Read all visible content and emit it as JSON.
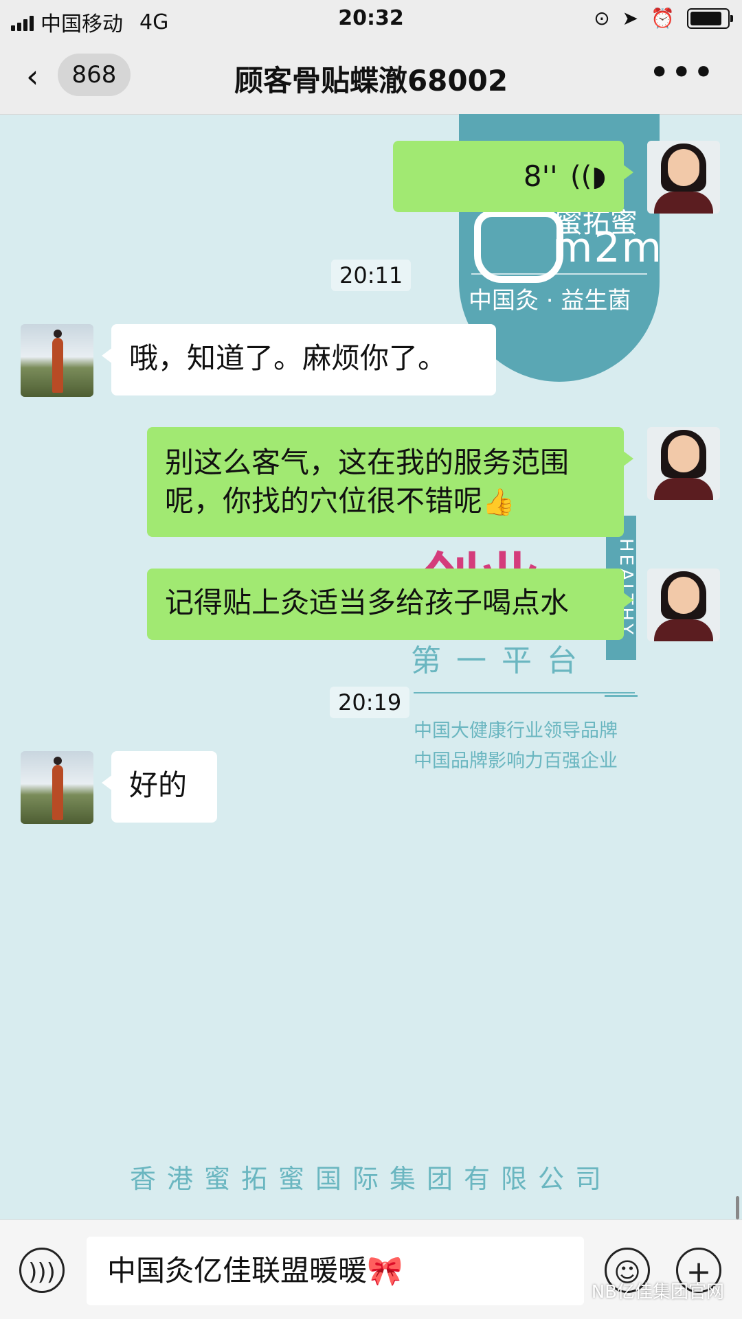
{
  "status_bar": {
    "carrier": "中国移动",
    "network": "4G",
    "time": "20:32",
    "battery_level": 0.9
  },
  "navbar": {
    "unread_badge": "868",
    "title": "顾客骨贴蝶澈68002",
    "more_label": "•••"
  },
  "background_poster": {
    "brand": "蜜拓蜜",
    "brand_latin": "m2m",
    "slogan": "中国灸 · 益生菌",
    "vertical_text": "HEALTHY",
    "platform_text": "第一平台",
    "tagline_1": "中国大健康行业领导品牌",
    "tagline_2": "中国品牌影响力百强企业",
    "company": "香港蜜拓蜜国际集团有限公司"
  },
  "messages": [
    {
      "type": "voice",
      "sender": "me",
      "duration": "8''"
    },
    {
      "type": "timestamp",
      "text": "20:11"
    },
    {
      "type": "text",
      "sender": "them",
      "text": "哦，知道了。麻烦你了。"
    },
    {
      "type": "text",
      "sender": "me",
      "line1": "别这么客气，这在我的服务范围",
      "line2": "呢，你找的穴位很不错呢",
      "emoji": "👍"
    },
    {
      "type": "text",
      "sender": "me",
      "text": "记得贴上灸适当多给孩子喝点水"
    },
    {
      "type": "timestamp",
      "text": "20:19"
    },
    {
      "type": "text",
      "sender": "them",
      "text": "好的"
    }
  ],
  "input_bar": {
    "voice_icon": "voice-icon",
    "draft_text": "中国灸亿佳联盟暖暖",
    "draft_emoji": "🎀",
    "emoji_icon": "smiley-icon",
    "plus_icon": "plus-icon",
    "watermark": "NB亿佳集团官网"
  }
}
